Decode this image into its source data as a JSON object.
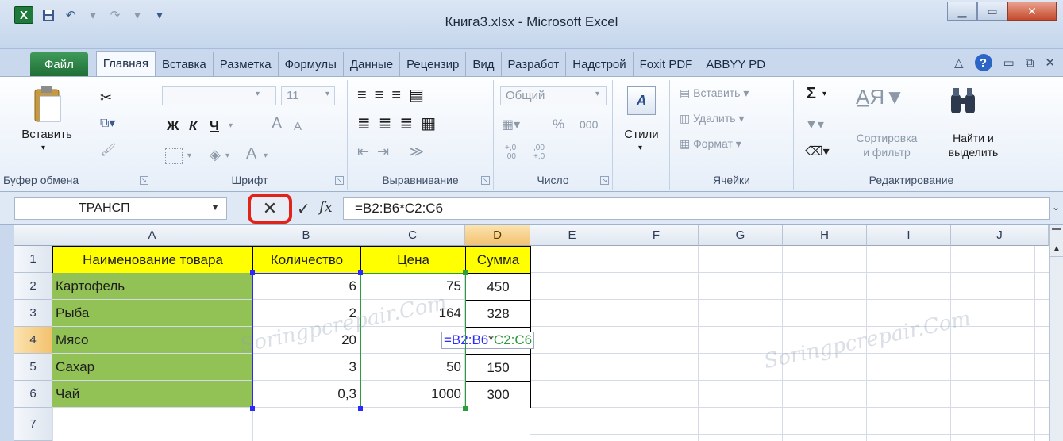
{
  "window": {
    "title": "Книга3.xlsx  -  Microsoft Excel",
    "app_logo": "X"
  },
  "tabs": [
    "Файл",
    "Главная",
    "Вставка",
    "Разметка",
    "Формулы",
    "Данные",
    "Рецензир",
    "Вид",
    "Разработ",
    "Надстрой",
    "Foxit PDF",
    "ABBYY PD"
  ],
  "active_tab": "Главная",
  "ribbon": {
    "clipboard": {
      "paste": "Вставить",
      "label": "Буфер обмена"
    },
    "font": {
      "size": "11",
      "bold": "Ж",
      "italic": "К",
      "underline": "Ч",
      "grow": "A",
      "shrink": "A",
      "fontcolor": "A",
      "label": "Шрифт"
    },
    "alignment": {
      "label": "Выравнивание"
    },
    "number": {
      "format": "Общий",
      "percent": "%",
      "thousands": "000",
      "inc": "+,0\n,00",
      "dec": ",00\n+,0",
      "label": "Число"
    },
    "styles": {
      "label": "Стили"
    },
    "cells": {
      "insert": "Вставить",
      "delete": "Удалить",
      "format": "Формат",
      "label": "Ячейки"
    },
    "editing": {
      "sum": "Σ",
      "sort": "Сортировка\nи фильтр",
      "find": "Найти и\nвыделить",
      "label": "Редактирование"
    }
  },
  "formula_bar": {
    "name_box": "ТРАНСП",
    "cancel": "✕",
    "enter": "✓",
    "fx": "fx",
    "formula": "=B2:B6*C2:C6"
  },
  "columns": [
    "A",
    "B",
    "C",
    "D",
    "E",
    "F",
    "G",
    "H",
    "I",
    "J"
  ],
  "rows": [
    "1",
    "2",
    "3",
    "4",
    "5",
    "6",
    "7"
  ],
  "table": {
    "headers": [
      "Наименование товара",
      "Количество",
      "Цена",
      "Сумма"
    ],
    "rows": [
      [
        "Картофель",
        "6",
        "75",
        "450"
      ],
      [
        "Рыба",
        "2",
        "164",
        "328"
      ],
      [
        "Мясо",
        "20",
        "",
        ""
      ],
      [
        "Сахар",
        "3",
        "50",
        "150"
      ],
      [
        "Чай",
        "0,3",
        "1000",
        "300"
      ]
    ],
    "editing_cell": {
      "part1": "=B2:B6",
      "part2": "*",
      "part3": "C2:C6"
    }
  },
  "colors": {
    "header_fill": "#ffff00",
    "name_fill": "#92c156",
    "ref_blue": "#2a2aff",
    "ref_green": "#2a9e3a",
    "highlight": "#e2231a"
  },
  "watermark": "Soringpcrepair.Com"
}
